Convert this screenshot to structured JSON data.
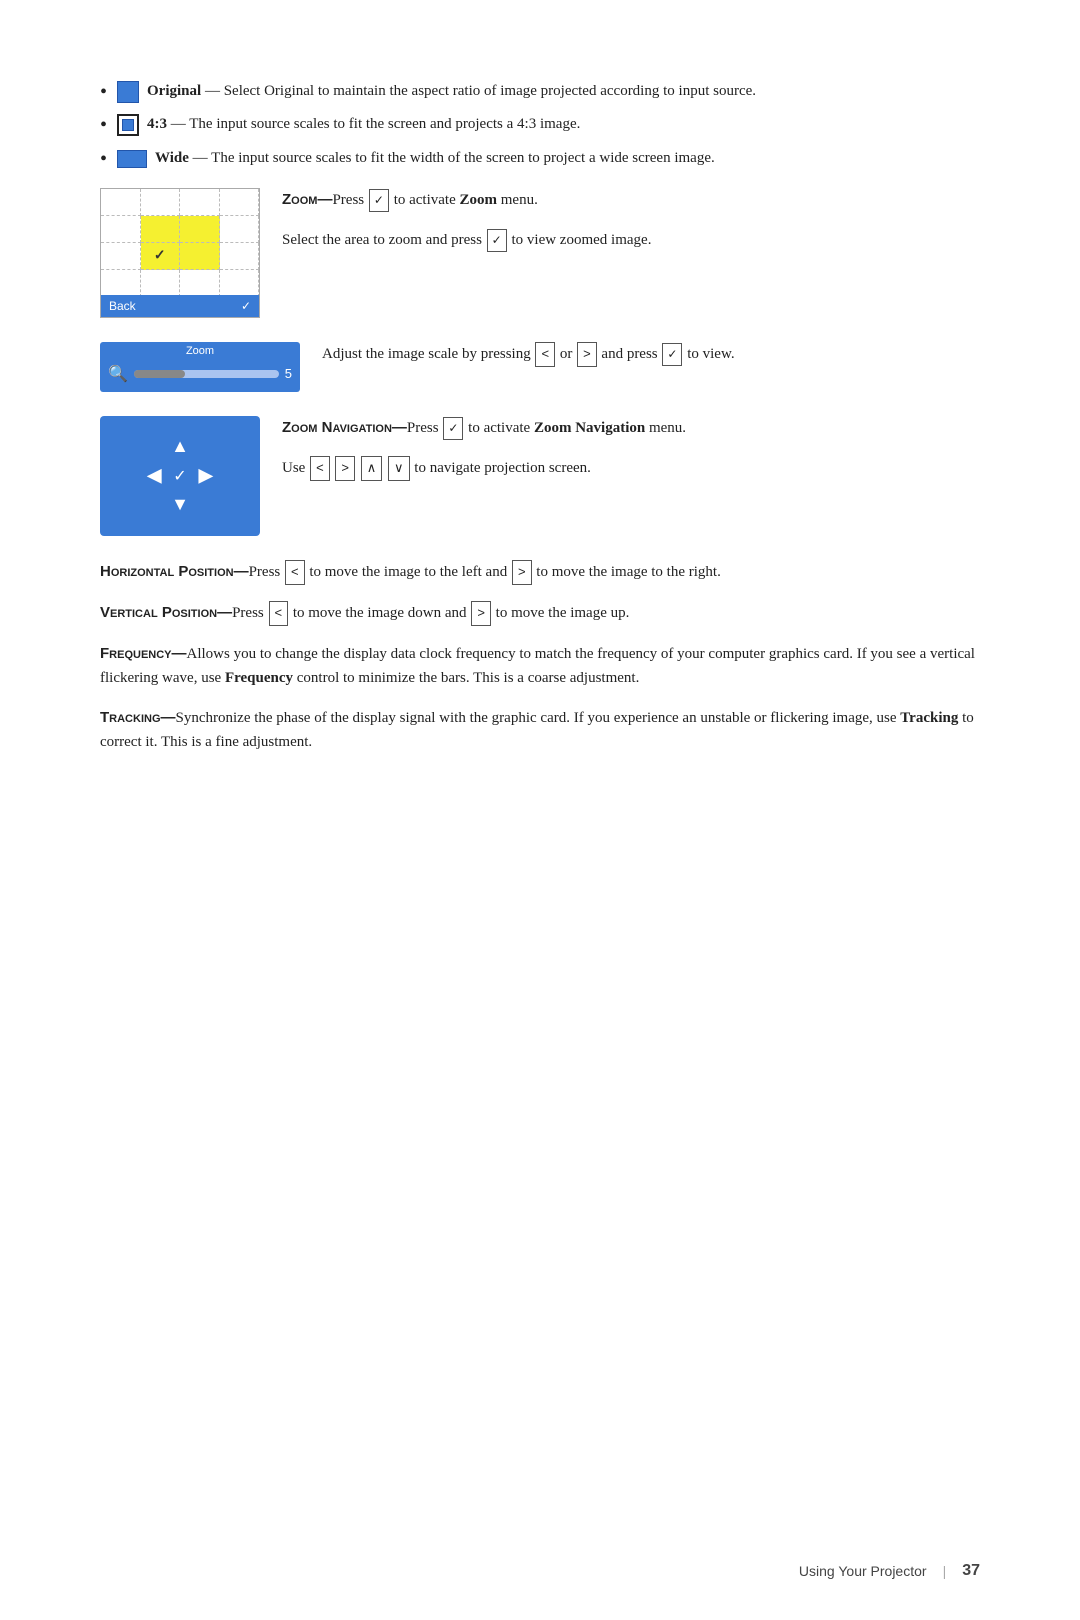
{
  "bullets": [
    {
      "icon": "original",
      "text_before": "Original",
      "text_after": "— Select Original to maintain the aspect ratio of image projected according to input source."
    },
    {
      "icon": "43",
      "text_before": "4:3",
      "text_after": "— The input source scales to fit the screen and projects a 4:3 image."
    },
    {
      "icon": "wide",
      "text_before": "Wide",
      "text_after": "— The input source scales to fit the width of the screen to project a wide screen image."
    }
  ],
  "zoom_section": {
    "heading": "Zoom",
    "heading_full": "Zoom—",
    "press_check": "✓",
    "text1": "Press",
    "text2": "to activate",
    "bold1": "Zoom",
    "text3": "menu.",
    "text4": "Select the area to zoom and press",
    "text5": "to view zoomed image.",
    "back_label": "Back",
    "check_label": "✓"
  },
  "zoom_slider_section": {
    "label": "Zoom",
    "number": "5",
    "text1": "Adjust the image scale by pressing",
    "left_btn": "<",
    "text2": "or",
    "right_btn": ">",
    "text3": "and press",
    "check_btn": "✓",
    "text4": "to view."
  },
  "zoom_nav_section": {
    "heading": "Zoom Navigation",
    "heading_prefix": "Zoom Navigation—",
    "text1": "Press",
    "check_btn": "✓",
    "text2": "to activate",
    "bold1": "Zoom Navigation",
    "text3": "menu.",
    "text4": "Use",
    "btn_left": "<",
    "btn_right": ">",
    "btn_up": "∧",
    "btn_down": "∨",
    "text5": "to navigate projection screen."
  },
  "horizontal_section": {
    "heading": "Horizontal Position",
    "heading_prefix": "Horizontal Position—",
    "text1": "Press",
    "btn_left": "<",
    "text2": "to move the image to the left and",
    "btn_right": ">",
    "text3": "to move the image to the right."
  },
  "vertical_section": {
    "heading": "Vertical Position",
    "heading_prefix": "Vertical Position—",
    "text1": "Press",
    "btn_left": "<",
    "text2": "to move the image down and",
    "btn_right": ">",
    "text3": "to move the image up."
  },
  "frequency_section": {
    "heading": "Frequency",
    "heading_prefix": "Frequency—",
    "text": "Allows you to change the display data clock frequency to match the frequency of your computer graphics card. If you see a vertical flickering wave, use",
    "bold_word": "Frequency",
    "text2": "control to minimize the bars. This is a coarse adjustment."
  },
  "tracking_section": {
    "heading": "Tracking",
    "heading_prefix": "Tracking—",
    "text": "Synchronize the phase of the display signal with the graphic card. If you experience an unstable or flickering image, use",
    "bold_word": "Tracking",
    "text2": "to correct it. This is a fine adjustment."
  },
  "footer": {
    "label": "Using Your Projector",
    "separator": "|",
    "page_number": "37"
  }
}
